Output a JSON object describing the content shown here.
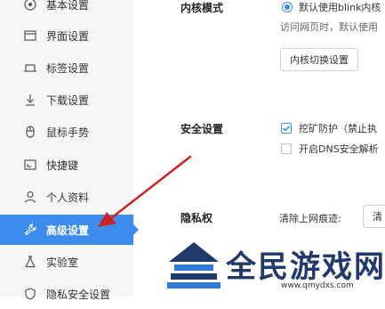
{
  "sidebar": {
    "items": [
      {
        "label": "基本设置",
        "icon": "target-icon"
      },
      {
        "label": "界面设置",
        "icon": "window-icon"
      },
      {
        "label": "标签设置",
        "icon": "tab-icon"
      },
      {
        "label": "下载设置",
        "icon": "download-icon"
      },
      {
        "label": "鼠标手势",
        "icon": "mouse-icon"
      },
      {
        "label": "快捷键",
        "icon": "keyboard-icon"
      },
      {
        "label": "个人资料",
        "icon": "user-icon"
      },
      {
        "label": "高级设置",
        "icon": "wrench-icon",
        "active": true
      },
      {
        "label": "实验室",
        "icon": "flask-icon"
      },
      {
        "label": "隐私安全设置",
        "icon": "shield-icon"
      }
    ],
    "active_color": "#3b8ced"
  },
  "main": {
    "kernel": {
      "title": "内核模式",
      "radio_label": "默认使用blink内核",
      "note": "访问网页时，默认使用",
      "switch_button": "内核切换设置"
    },
    "security": {
      "title": "安全设置",
      "mining_label": "挖矿防护（禁止执",
      "mining_checked": true,
      "dns_label": "开启DNS安全解析",
      "dns_checked": false
    },
    "privacy": {
      "title": "隐私权",
      "clear_label": "清除上网痕迹:",
      "clear_button": "清"
    }
  },
  "watermark": {
    "title": "全民游戏网",
    "url": "www.qmydxs.com"
  },
  "annotation_arrow_color": "#cc2222"
}
